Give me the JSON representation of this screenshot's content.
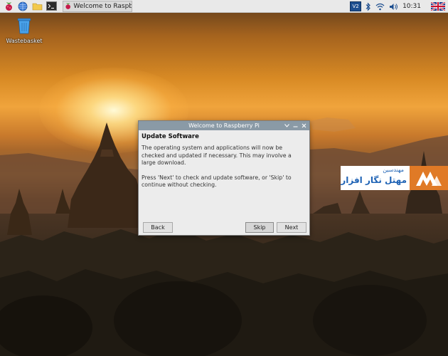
{
  "taskbar": {
    "task_label": "Welcome to Raspberr...",
    "tray": {
      "vnc_label": "V2",
      "clock": "10:31"
    },
    "icons": [
      "raspberry-icon",
      "globe-icon",
      "folder-icon",
      "terminal-icon"
    ]
  },
  "desktop": {
    "wastebasket_label": "Wastebasket"
  },
  "dialog": {
    "window_title": "Welcome to Raspberry Pi",
    "heading": "Update Software",
    "paragraph1": "The operating system and applications will now be checked and updated if necessary. This may involve a large download.",
    "paragraph2": "Press 'Next' to check and update software, or 'Skip' to continue without checking.",
    "back_label": "Back",
    "skip_label": "Skip",
    "next_label": "Next"
  },
  "watermark": {
    "line1": "مهندسین",
    "line2": "مهتل نگار افزار"
  },
  "colors": {
    "taskbar_bg": "#e9e9e9",
    "titlebar": "#8a9aa6",
    "dialog_bg": "#ececec",
    "watermark_orange": "#e07a26",
    "watermark_blue": "#1f63b5"
  }
}
